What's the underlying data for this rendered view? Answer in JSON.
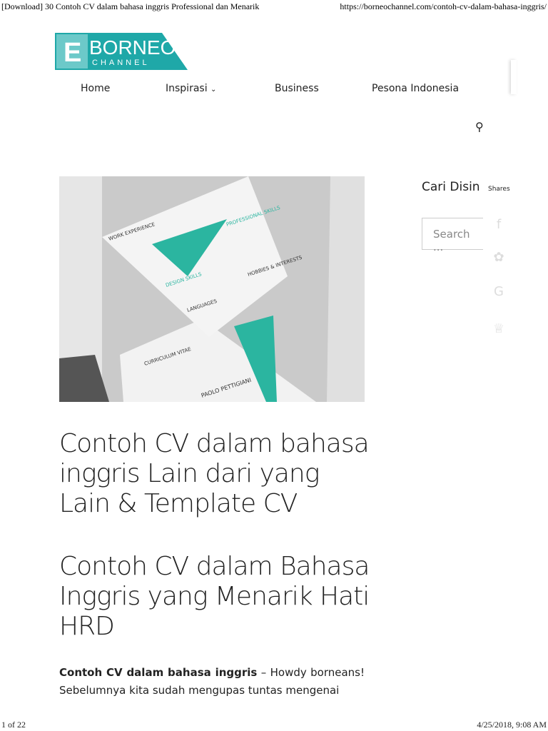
{
  "print_header": {
    "title": "[Download] 30 Contoh CV  dalam bahasa inggris Professional dan Menarik",
    "url": "https://borneochannel.com/contoh-cv-dalam-bahasa-inggris/"
  },
  "logo": {
    "text": "BORNEO",
    "subtext": "CHANNEL",
    "color": "#1fa8a8"
  },
  "nav": {
    "items": [
      "Home",
      "Inspirasi",
      "Business",
      "Pesona Indonesia"
    ]
  },
  "hero": {
    "cv_labels": [
      "WORK EXPERIENCE",
      "PROFESSIONAL SKILLS",
      "HOBBIES & INTERESTS",
      "DESIGN SKILLS",
      "LANGUAGES",
      "CURRICULUM VITAE",
      "PAOLO PETTIGIANI"
    ],
    "accent": "#2bb5a0"
  },
  "article": {
    "title": "Contoh CV dalam bahasa inggris Lain dari yang Lain & Template CV",
    "subtitle": "Contoh CV dalam Bahasa Inggris yang Menarik Hati HRD",
    "intro_bold": "Contoh CV dalam bahasa inggris",
    "intro": " – Howdy borneans! Sebelumnya kita sudah mengupas tuntas mengenai"
  },
  "sidebar": {
    "title": "Cari Disin",
    "search_placeholder": "Search ..."
  },
  "share": {
    "label": "Shares",
    "icons": [
      "facebook-icon",
      "twitter-icon",
      "google-plus-icon",
      "crown-icon"
    ]
  },
  "print_footer": {
    "page": "1 of 22",
    "datetime": "4/25/2018, 9:08 AM"
  }
}
